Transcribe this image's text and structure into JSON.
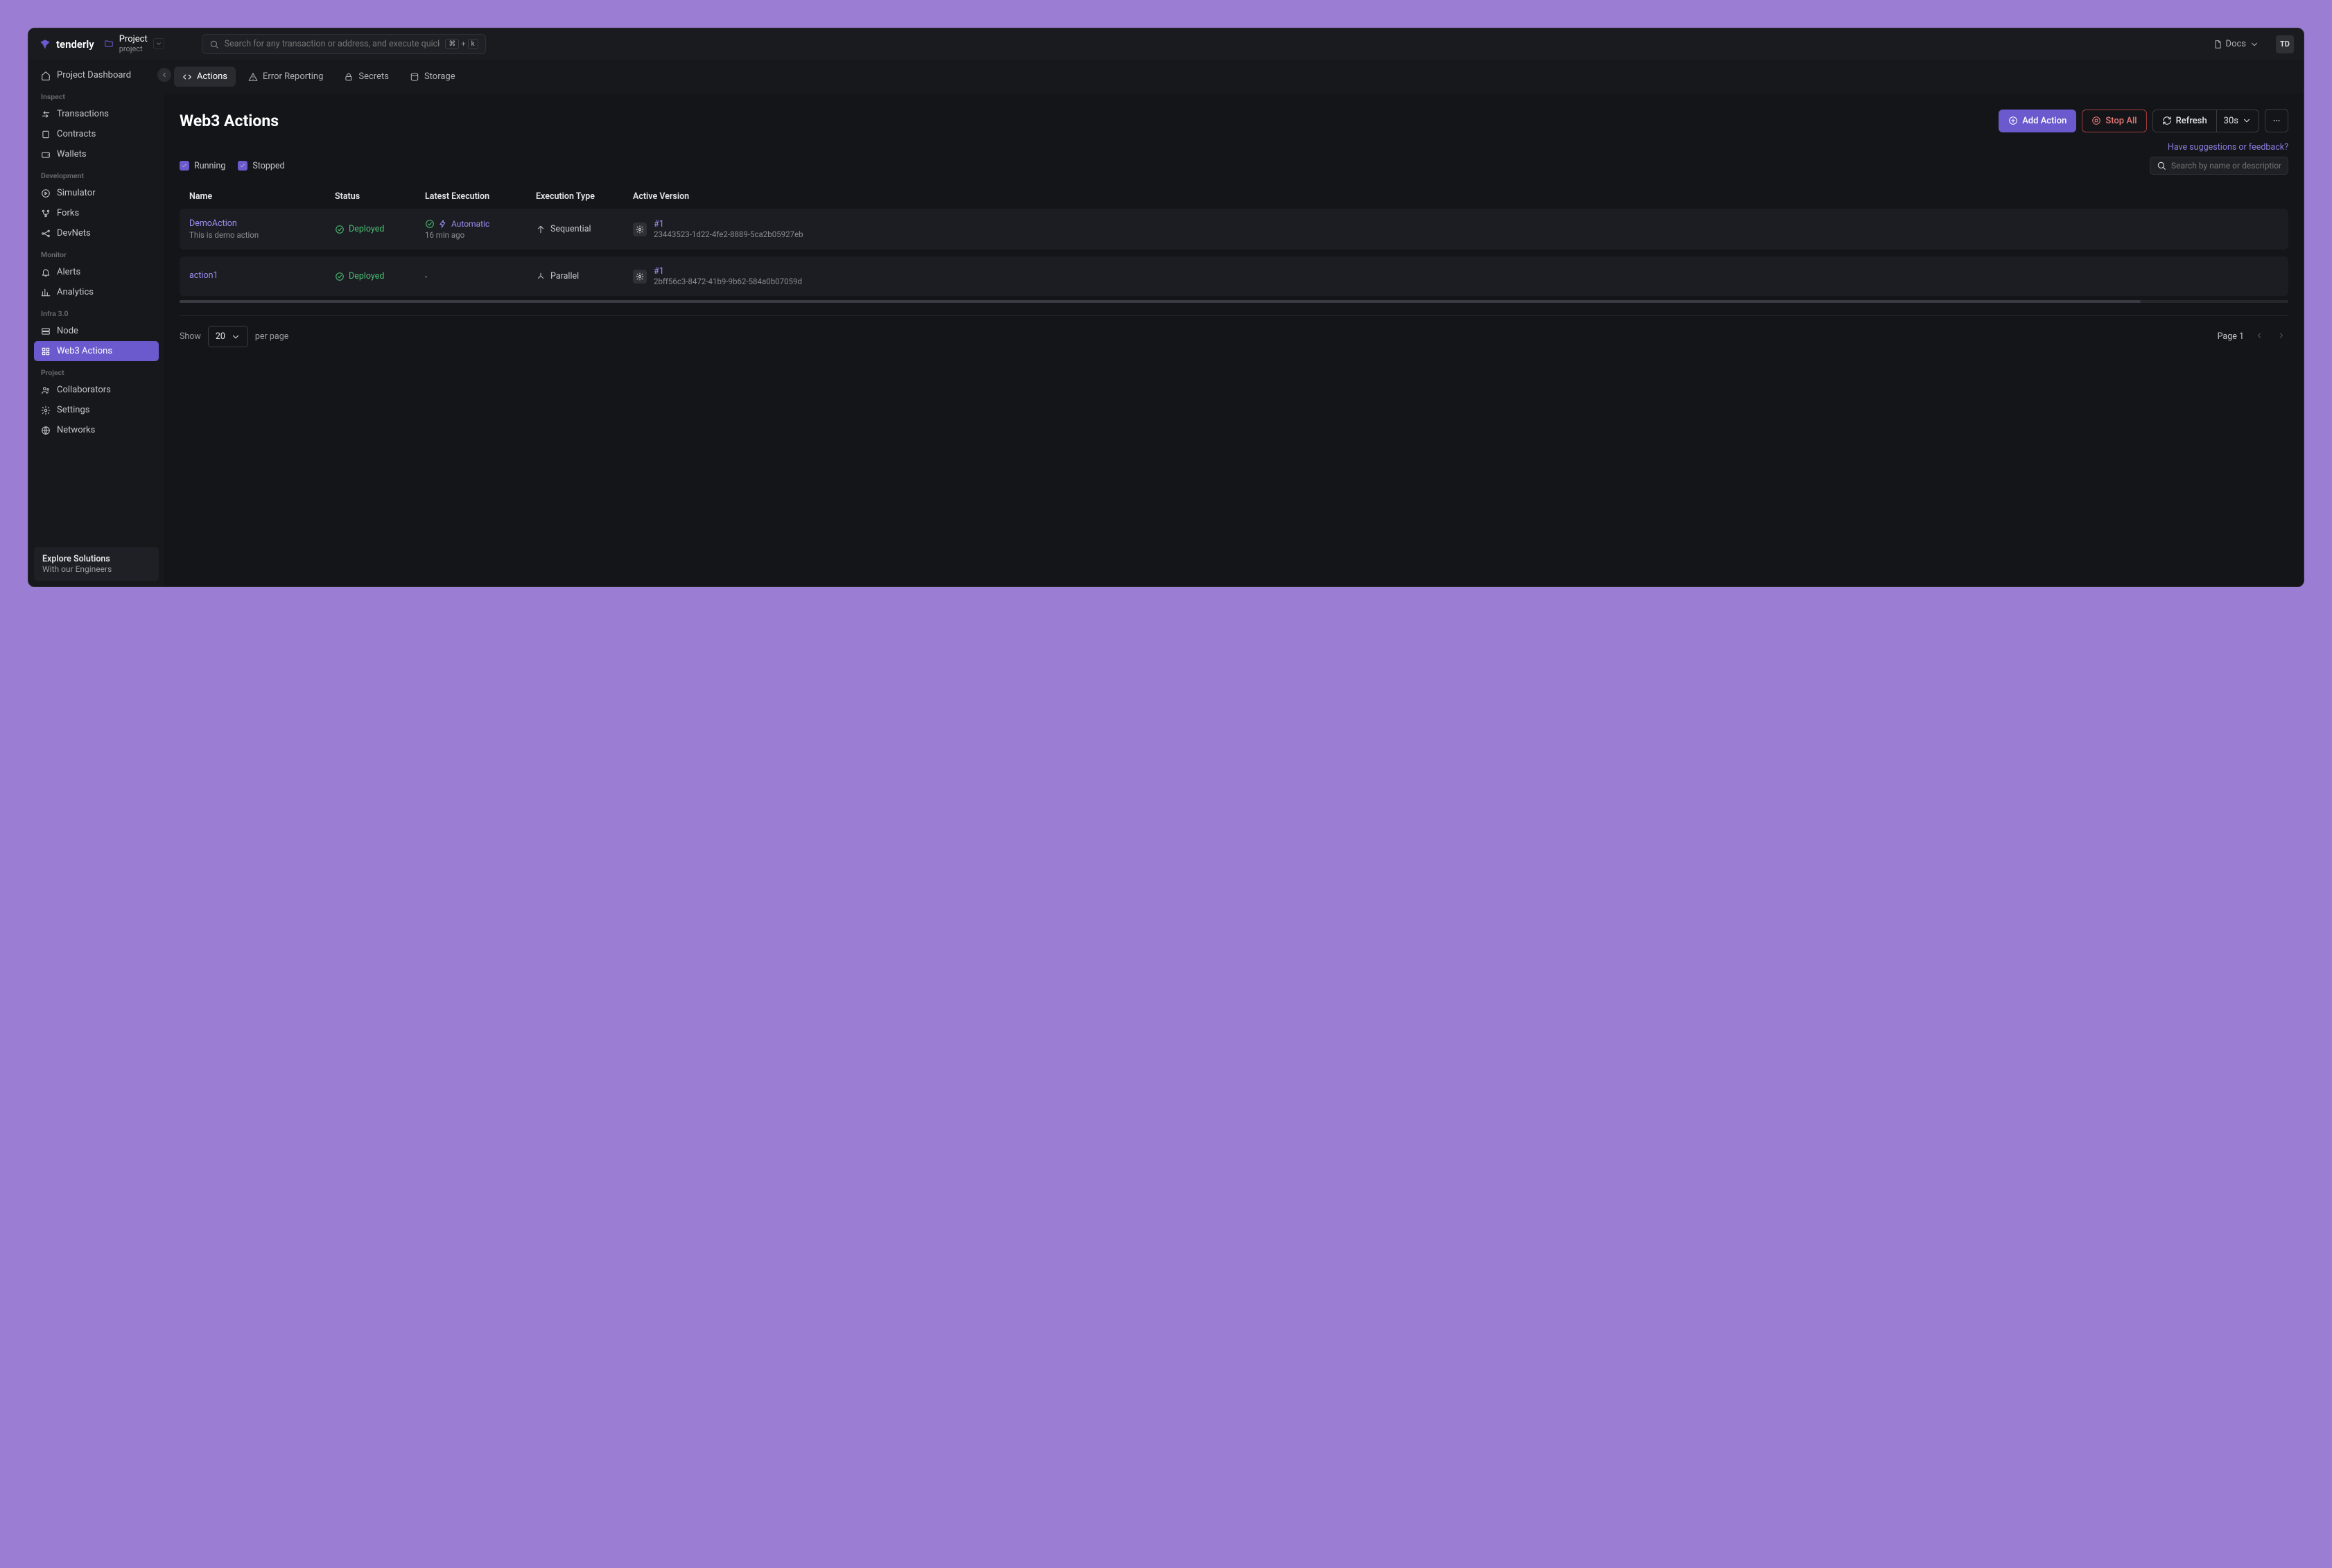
{
  "brand": "tenderly",
  "project": {
    "name": "Project",
    "sub": "project"
  },
  "search": {
    "placeholder": "Search for any transaction or address, and execute quick c...",
    "kbd_mod": "⌘",
    "kbd_plus": "+",
    "kbd_key": "k"
  },
  "docs_label": "Docs",
  "avatar": "TD",
  "sidebar": {
    "dashboard": "Project Dashboard",
    "sections": {
      "inspect": {
        "label": "Inspect",
        "items": [
          "Transactions",
          "Contracts",
          "Wallets"
        ]
      },
      "development": {
        "label": "Development",
        "items": [
          "Simulator",
          "Forks",
          "DevNets"
        ]
      },
      "monitor": {
        "label": "Monitor",
        "items": [
          "Alerts",
          "Analytics"
        ]
      },
      "infra": {
        "label": "Infra 3.0",
        "items": [
          "Node",
          "Web3 Actions"
        ]
      },
      "project": {
        "label": "Project",
        "items": [
          "Collaborators",
          "Settings",
          "Networks"
        ]
      }
    },
    "footer": {
      "title": "Explore Solutions",
      "sub": "With our Engineers"
    }
  },
  "subnav": {
    "items": [
      "Actions",
      "Error Reporting",
      "Secrets",
      "Storage"
    ]
  },
  "page": {
    "title": "Web3 Actions",
    "add": "Add Action",
    "stop": "Stop All",
    "refresh": "Refresh",
    "interval": "30s",
    "feedback": "Have suggestions or feedback?"
  },
  "filters": {
    "running": "Running",
    "stopped": "Stopped",
    "search_placeholder": "Search by name or description"
  },
  "table": {
    "headers": [
      "Name",
      "Status",
      "Latest Execution",
      "Execution Type",
      "Active Version"
    ],
    "rows": [
      {
        "name": "DemoAction",
        "desc": "This is demo action",
        "status": "Deployed",
        "exec_label": "Automatic",
        "exec_time": "16 min ago",
        "exec_type": "Sequential",
        "version_link": "#1",
        "version_hash": "23443523-1d22-4fe2-8889-5ca2b05927eb"
      },
      {
        "name": "action1",
        "desc": "",
        "status": "Deployed",
        "exec_label": "-",
        "exec_time": "",
        "exec_type": "Parallel",
        "version_link": "#1",
        "version_hash": "2bff56c3-8472-41b9-9b62-584a0b07059d"
      }
    ]
  },
  "pagination": {
    "show": "Show",
    "page_size": "20",
    "per_page": "per page",
    "page_label": "Page 1"
  }
}
